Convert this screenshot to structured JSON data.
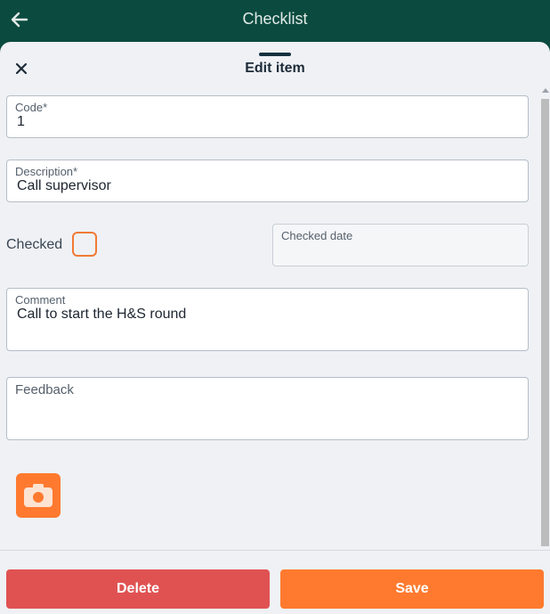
{
  "header": {
    "title": "Checklist",
    "back_icon": "arrow-left-icon",
    "background": "#0b4a3f"
  },
  "sheet": {
    "title": "Edit item",
    "close_icon": "close-icon"
  },
  "form": {
    "code": {
      "label": "Code*",
      "value": "1"
    },
    "description": {
      "label": "Description*",
      "value": "Call supervisor"
    },
    "checked": {
      "label": "Checked",
      "value": false
    },
    "checked_date": {
      "label": "Checked date",
      "value": ""
    },
    "comment": {
      "label": "Comment",
      "value": "Call to start the H&S round"
    },
    "feedback": {
      "label": "Feedback",
      "value": ""
    }
  },
  "camera": {
    "icon": "camera-icon",
    "color": "#ff7a2f"
  },
  "actions": {
    "delete_label": "Delete",
    "save_label": "Save",
    "delete_color": "#e05252",
    "save_color": "#ff7a2f"
  }
}
